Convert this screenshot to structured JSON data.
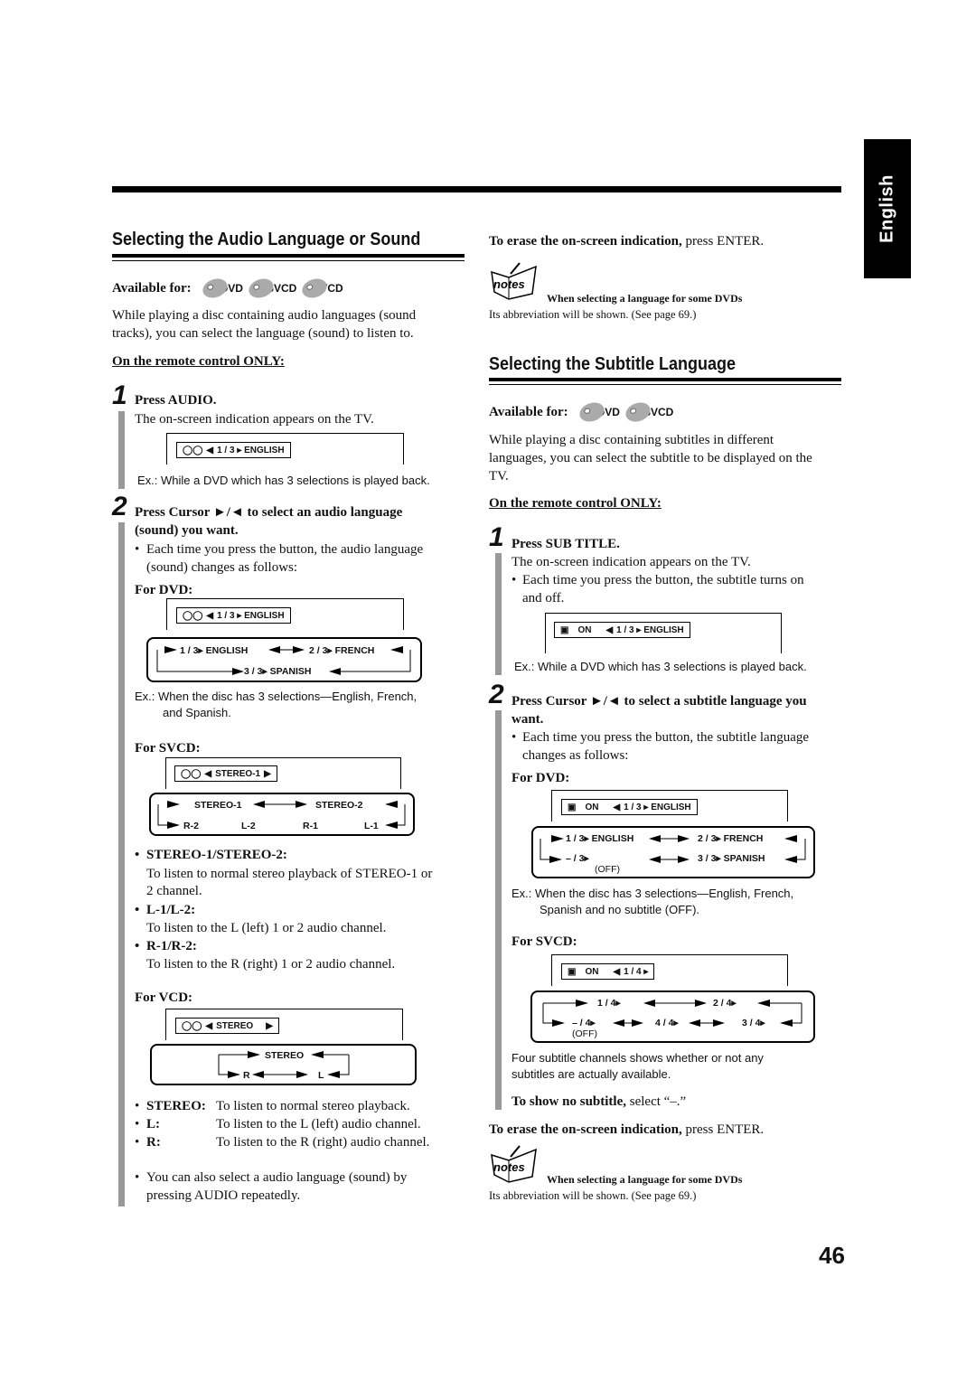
{
  "side_tab": {
    "label": "English"
  },
  "page_number": "46",
  "audio": {
    "title": "Selecting the Audio Language or Sound",
    "available_label": "Available for:",
    "discs": [
      "DVD",
      "SVCD",
      "VCD"
    ],
    "intro": "While playing a disc containing audio languages (sound tracks), you can select the language (sound) to listen to.",
    "remote_only": "On the remote control ONLY:",
    "step1": {
      "num": "1",
      "title": "Press AUDIO.",
      "desc": "The on-screen indication appears on the TV.",
      "osd": "1 / 3 ▸ ENGLISH",
      "example": "Ex.: While a DVD which has 3 selections is played back."
    },
    "step2": {
      "num": "2",
      "title_line1": "Press Cursor ►/◄ to select an audio language",
      "title_line2": "(sound) you want.",
      "bullet_line1": "Each time you press the button, the audio language",
      "bullet_line2": "(sound) changes as follows:"
    },
    "for_dvd": {
      "label": "For DVD:",
      "osd": "1 / 3 ▸ ENGLISH",
      "cycle": [
        "1 / 3▸ ENGLISH",
        "2 / 3▸ FRENCH",
        "3 / 3▸ SPANISH"
      ],
      "example_line1": "Ex.:  When the disc has 3 selections—English, French,",
      "example_line2": "and Spanish."
    },
    "for_svcd": {
      "label": "For SVCD:",
      "osd": "STEREO-1",
      "cycle_top": [
        "STEREO-1",
        "STEREO-2"
      ],
      "cycle_bottom": [
        "R-2",
        "L-2",
        "R-1",
        "L-1"
      ]
    },
    "svcd_notes": [
      {
        "term": "STEREO-1/STEREO-2:",
        "desc_line1": "To listen to normal stereo playback of STEREO-1 or",
        "desc_line2": "2 channel."
      },
      {
        "term": "L-1/L-2:",
        "desc_line1": "To listen to the L (left) 1 or 2 audio channel."
      },
      {
        "term": "R-1/R-2:",
        "desc_line1": "To listen to the R (right) 1 or 2 audio channel."
      }
    ],
    "for_vcd": {
      "label": "For VCD:",
      "osd": "STEREO",
      "cycle": [
        "STEREO",
        "R",
        "L"
      ]
    },
    "vcd_notes": [
      {
        "term": "STEREO:",
        "desc": "To listen to normal stereo playback."
      },
      {
        "term": "L:",
        "desc": "To listen to the L (left) audio channel."
      },
      {
        "term": "R:",
        "desc": "To listen to the R (right) audio channel."
      }
    ],
    "tip_line1": "You can also select a audio language (sound) by",
    "tip_line2": "pressing AUDIO repeatedly."
  },
  "erase1": {
    "bold": "To erase the on-screen indication,",
    "rest": " press ENTER."
  },
  "notes1": {
    "icon_label": "notes",
    "title": "When selecting a language for some DVDs",
    "text": "Its abbreviation will be shown. (See page 69.)"
  },
  "subtitle": {
    "title": "Selecting the Subtitle Language",
    "available_label": "Available for:",
    "discs": [
      "DVD",
      "SVCD"
    ],
    "intro_line1": "While playing a disc containing subtitles in different",
    "intro_line2": "languages, you can select the subtitle to be displayed on the",
    "intro_line3": "TV.",
    "remote_only": "On the remote control ONLY:",
    "step1": {
      "num": "1",
      "title": "Press SUB TITLE.",
      "desc": "The on-screen indication appears on the TV.",
      "bullet_line1": "Each time you press the button, the subtitle turns on",
      "bullet_line2": "and off.",
      "osd_on": "ON",
      "osd": "1 / 3 ▸ ENGLISH",
      "example": "Ex.: While a DVD which has 3 selections is played back."
    },
    "step2": {
      "num": "2",
      "title_line1": "Press Cursor ►/◄ to select a subtitle language you",
      "title_line2": "want.",
      "bullet_line1": "Each time you press the button, the subtitle language",
      "bullet_line2": "changes as follows:"
    },
    "for_dvd": {
      "label": "For DVD:",
      "osd_on": "ON",
      "osd": "1 / 3 ▸ ENGLISH",
      "cycle": [
        "1 / 3▸ ENGLISH",
        "2 / 3▸ FRENCH",
        "3 / 3▸ SPANISH",
        "– / 3▸"
      ],
      "off_label": "(OFF)",
      "example_line1": "Ex.:  When the disc has 3 selections—English, French,",
      "example_line2": "Spanish and no subtitle (OFF)."
    },
    "for_svcd": {
      "label": "For SVCD:",
      "osd_on": "ON",
      "osd": "1 / 4 ▸",
      "cycle": [
        "1 / 4▸",
        "2 / 4▸",
        "3 / 4▸",
        "4 / 4▸",
        "– / 4▸"
      ],
      "off_label": "(OFF)",
      "note_line1": "Four subtitle channels shows whether or not any",
      "note_line2": "subtitles are actually available."
    },
    "no_subtitle": {
      "bold": "To show no subtitle,",
      "rest": " select “–.”"
    }
  },
  "erase2": {
    "bold": "To erase the on-screen indication,",
    "rest": " press ENTER."
  },
  "notes2": {
    "icon_label": "notes",
    "title": "When selecting a language for some DVDs",
    "text": "Its abbreviation will be shown. (See page 69.)"
  }
}
